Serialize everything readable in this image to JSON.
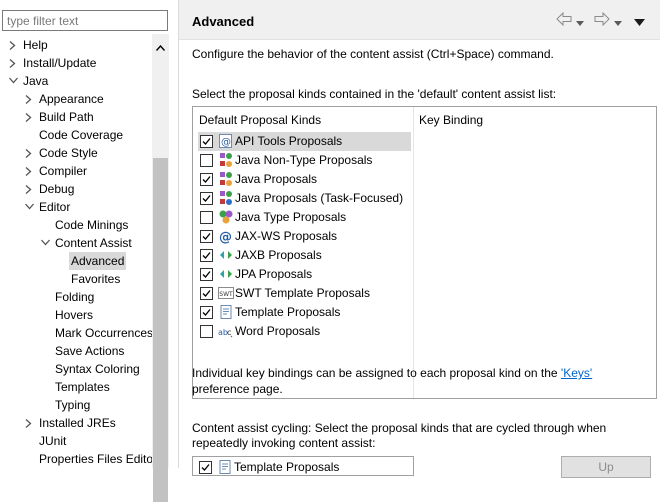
{
  "filter": {
    "placeholder": "type filter text"
  },
  "tree": [
    {
      "label": "Help",
      "level": 0,
      "twisty": "collapsed"
    },
    {
      "label": "Install/Update",
      "level": 0,
      "twisty": "collapsed"
    },
    {
      "label": "Java",
      "level": 0,
      "twisty": "expanded"
    },
    {
      "label": "Appearance",
      "level": 1,
      "twisty": "collapsed"
    },
    {
      "label": "Build Path",
      "level": 1,
      "twisty": "collapsed"
    },
    {
      "label": "Code Coverage",
      "level": 1,
      "twisty": "none"
    },
    {
      "label": "Code Style",
      "level": 1,
      "twisty": "collapsed"
    },
    {
      "label": "Compiler",
      "level": 1,
      "twisty": "collapsed"
    },
    {
      "label": "Debug",
      "level": 1,
      "twisty": "collapsed"
    },
    {
      "label": "Editor",
      "level": 1,
      "twisty": "expanded"
    },
    {
      "label": "Code Minings",
      "level": 2,
      "twisty": "none"
    },
    {
      "label": "Content Assist",
      "level": 2,
      "twisty": "expanded"
    },
    {
      "label": "Advanced",
      "level": 3,
      "twisty": "none",
      "selected": true
    },
    {
      "label": "Favorites",
      "level": 3,
      "twisty": "none"
    },
    {
      "label": "Folding",
      "level": 2,
      "twisty": "none"
    },
    {
      "label": "Hovers",
      "level": 2,
      "twisty": "none"
    },
    {
      "label": "Mark Occurrences",
      "level": 2,
      "twisty": "none"
    },
    {
      "label": "Save Actions",
      "level": 2,
      "twisty": "none"
    },
    {
      "label": "Syntax Coloring",
      "level": 2,
      "twisty": "none"
    },
    {
      "label": "Templates",
      "level": 2,
      "twisty": "none"
    },
    {
      "label": "Typing",
      "level": 2,
      "twisty": "none"
    },
    {
      "label": "Installed JREs",
      "level": 1,
      "twisty": "collapsed"
    },
    {
      "label": "JUnit",
      "level": 1,
      "twisty": "none"
    },
    {
      "label": "Properties Files Editor",
      "level": 1,
      "twisty": "none"
    }
  ],
  "page": {
    "title": "Advanced",
    "description": "Configure the behavior of the content assist (Ctrl+Space) command.",
    "select_label": "Select the proposal kinds contained in the 'default' content assist list:",
    "col_default": "Default Proposal Kinds",
    "col_key": "Key Binding",
    "proposals": [
      {
        "label": "API Tools Proposals",
        "checked": true,
        "icon": "at-doc-icon",
        "selected": true
      },
      {
        "label": "Java Non-Type Proposals",
        "checked": false,
        "icon": "java-nontype-icon"
      },
      {
        "label": "Java Proposals",
        "checked": true,
        "icon": "java-proposals-icon"
      },
      {
        "label": "Java Proposals (Task-Focused)",
        "checked": true,
        "icon": "java-task-focused-icon"
      },
      {
        "label": "Java Type Proposals",
        "checked": false,
        "icon": "java-type-icon"
      },
      {
        "label": "JAX-WS Proposals",
        "checked": true,
        "icon": "at-sign-icon"
      },
      {
        "label": "JAXB Proposals",
        "checked": true,
        "icon": "arrows-icon"
      },
      {
        "label": "JPA Proposals",
        "checked": true,
        "icon": "arrows-icon"
      },
      {
        "label": "SWT Template Proposals",
        "checked": true,
        "icon": "swt-icon"
      },
      {
        "label": "Template Proposals",
        "checked": true,
        "icon": "template-icon"
      },
      {
        "label": "Word Proposals",
        "checked": false,
        "icon": "abc-icon"
      }
    ],
    "info_pre": "Individual key bindings can be assigned to each proposal kind on the ",
    "info_link": "'Keys'",
    "info_post": " preference page.",
    "cycle_label": "Content assist cycling: Select the proposal kinds that are cycled through when repeatedly invoking content assist:",
    "cycle_first": {
      "label": "Template Proposals",
      "checked": true,
      "icon": "template-icon"
    },
    "up_label": "Up"
  },
  "colors": {
    "selection": "#d9d9d9",
    "link": "#0066cc",
    "header_bg": "#f0f0f0"
  }
}
